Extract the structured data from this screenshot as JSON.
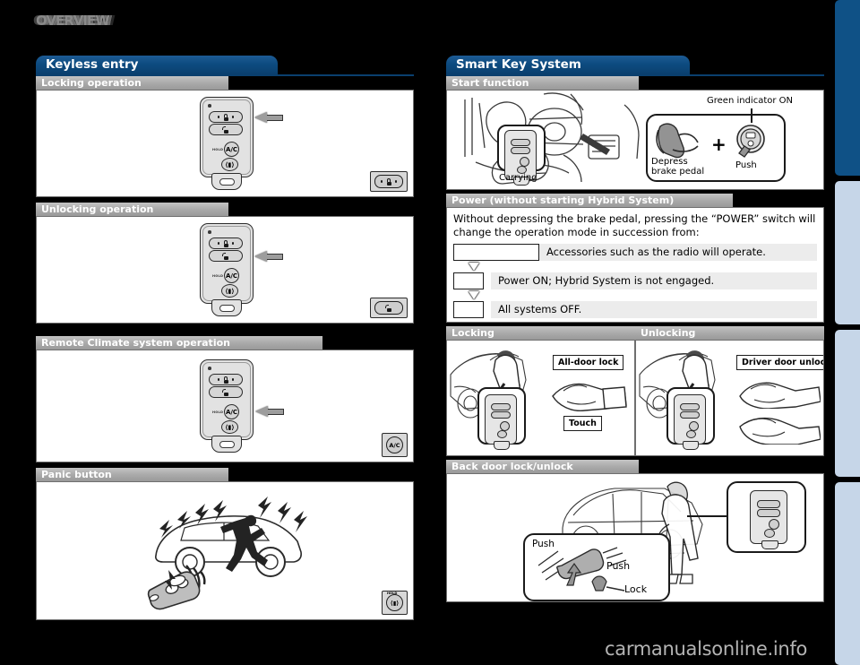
{
  "page": {
    "title": "OVERVIEW",
    "watermark": "carmanualsonline.info",
    "accent_blue": "#0d4b80",
    "sub_gray": "#a8a8a8",
    "tab_active": "#0f5186",
    "tab_idle": "#c6d6e8"
  },
  "left_column": {
    "section_title": "Keyless entry",
    "sections": [
      {
        "sub_title": "Locking operation",
        "figure": {
          "fob_buttons": [
            "lock",
            "unlock",
            "A/C",
            "panic"
          ],
          "hold_label": "HOLD",
          "pointer_target": "lock",
          "badge_icon": "lock-button-badge"
        }
      },
      {
        "sub_title": "Unlocking operation",
        "figure": {
          "fob_buttons": [
            "lock",
            "unlock",
            "A/C",
            "panic"
          ],
          "hold_label": "HOLD",
          "pointer_target": "unlock",
          "badge_icon": "unlock-button-badge"
        }
      },
      {
        "sub_title": "Remote Climate system operation",
        "figure": {
          "fob_buttons": [
            "lock",
            "unlock",
            "A/C",
            "panic"
          ],
          "hold_label": "HOLD",
          "pointer_target": "A/C",
          "badge_icon": "ac-button-badge",
          "badge_text": "A/C"
        }
      },
      {
        "sub_title": "Panic button",
        "figure": {
          "illustration": "car-alarm-with-fleeing-person-and-remote",
          "badge_icon": "panic-button-badge",
          "badge_hold_label": "HOLD"
        }
      }
    ]
  },
  "right_column": {
    "section_title": "Smart Key System",
    "start_function": {
      "sub_title": "Start function",
      "labels": {
        "carrying": "Carrying",
        "depress_brake_pedal": "Depress\nbrake pedal",
        "depress_brake_pedal_line1": "Depress",
        "depress_brake_pedal_line2": "brake pedal",
        "push": "Push",
        "green_indicator_on": "Green indicator ON",
        "plus": "+"
      }
    },
    "power": {
      "sub_title": "Power (without starting Hybrid System)",
      "intro": "Without depressing the brake pedal, pressing the “POWER” switch will change the operation mode in succession from:",
      "modes": [
        {
          "key": "",
          "key_width": "wide",
          "desc": "Accessories such as the radio will operate."
        },
        {
          "key": "",
          "key_width": "narrow",
          "desc": "Power ON; Hybrid System is not engaged."
        },
        {
          "key": "",
          "key_width": "narrow",
          "desc": "All systems OFF."
        }
      ]
    },
    "lock_unlock": {
      "locking": {
        "sub_title": "Locking",
        "callouts": [
          "All-door lock",
          "Touch"
        ],
        "illustration": "person-touching-door-handle-with-key-in-pocket"
      },
      "unlocking": {
        "sub_title": "Unlocking",
        "callouts": [
          "Driver door unlock*"
        ],
        "illustration": "person-gripping-door-handle-with-key-in-pocket"
      }
    },
    "back_door": {
      "sub_title": "Back door lock/unlock",
      "callouts": [
        "Push",
        "Push",
        "Lock"
      ],
      "illustration": "person-at-back-door-with-smart-key-callout"
    }
  },
  "side_tabs": [
    {
      "name": "tab-1",
      "state": "active"
    },
    {
      "name": "tab-2",
      "state": "idle"
    },
    {
      "name": "tab-3",
      "state": "idle"
    },
    {
      "name": "tab-4",
      "state": "idle"
    }
  ]
}
